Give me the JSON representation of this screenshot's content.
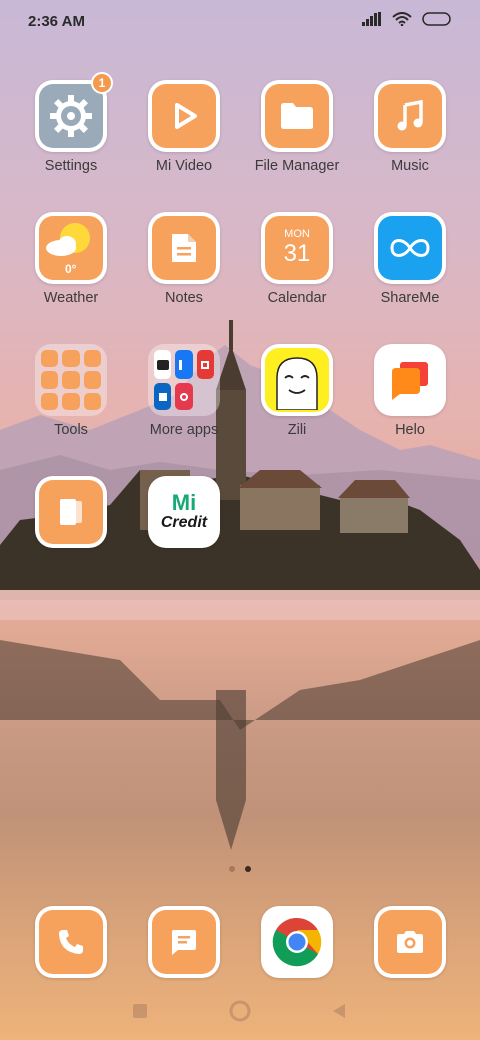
{
  "status_bar": {
    "time": "2:36 AM"
  },
  "apps": {
    "settings": {
      "label": "Settings",
      "badge": "1"
    },
    "mi_video": {
      "label": "Mi Video"
    },
    "file_manager": {
      "label": "File Manager"
    },
    "music": {
      "label": "Music"
    },
    "weather": {
      "label": "Weather",
      "temp": "0°"
    },
    "notes": {
      "label": "Notes"
    },
    "calendar": {
      "label": "Calendar",
      "day": "MON",
      "date": "31"
    },
    "shareme": {
      "label": "ShareMe"
    },
    "tools": {
      "label": "Tools"
    },
    "more_apps": {
      "label": "More apps"
    },
    "zili": {
      "label": "Zili"
    },
    "helo": {
      "label": "Helo"
    },
    "mi_credit": {
      "brand": "Mi",
      "text": "Credit"
    }
  },
  "page_indicator": {
    "total": 2,
    "active": 2
  },
  "colors": {
    "accent": "#f6a25d",
    "shareme": "#1aa1f0",
    "zili": "#ffee20",
    "mi_credit": "#19a974"
  }
}
